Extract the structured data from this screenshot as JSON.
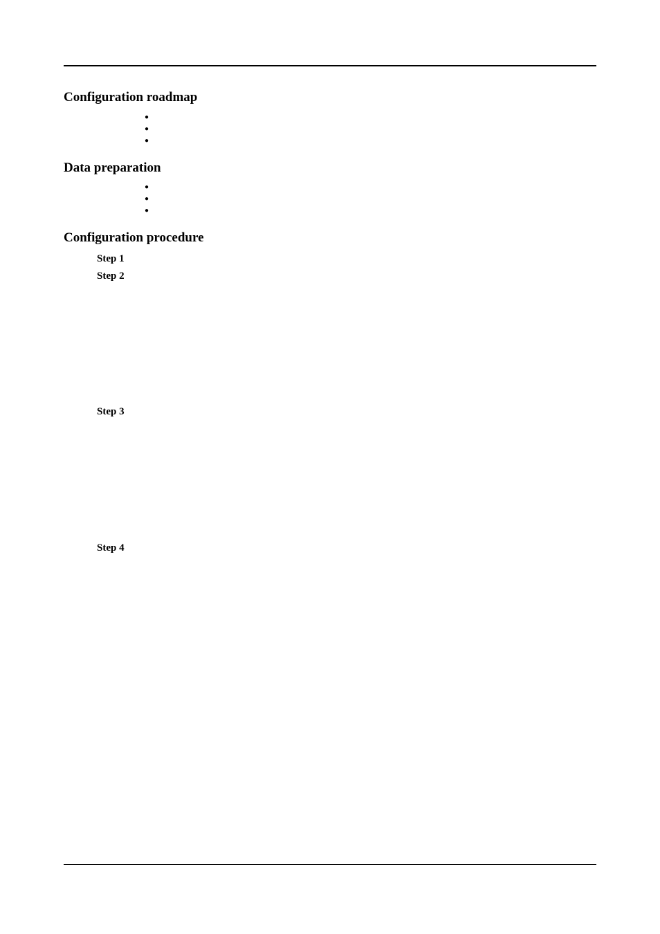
{
  "sections": {
    "roadmap": {
      "heading": "Configuration roadmap",
      "items": [
        "",
        "",
        ""
      ]
    },
    "prep": {
      "heading": "Data preparation",
      "items": [
        "",
        "",
        ""
      ]
    },
    "procedure": {
      "heading": "Configuration procedure",
      "steps": {
        "s1": {
          "label": "Step 1",
          "text": ""
        },
        "s2": {
          "label": "Step 2",
          "text": ""
        },
        "s3": {
          "label": "Step 3",
          "text": ""
        },
        "s4": {
          "label": "Step 4",
          "text": ""
        }
      }
    }
  }
}
